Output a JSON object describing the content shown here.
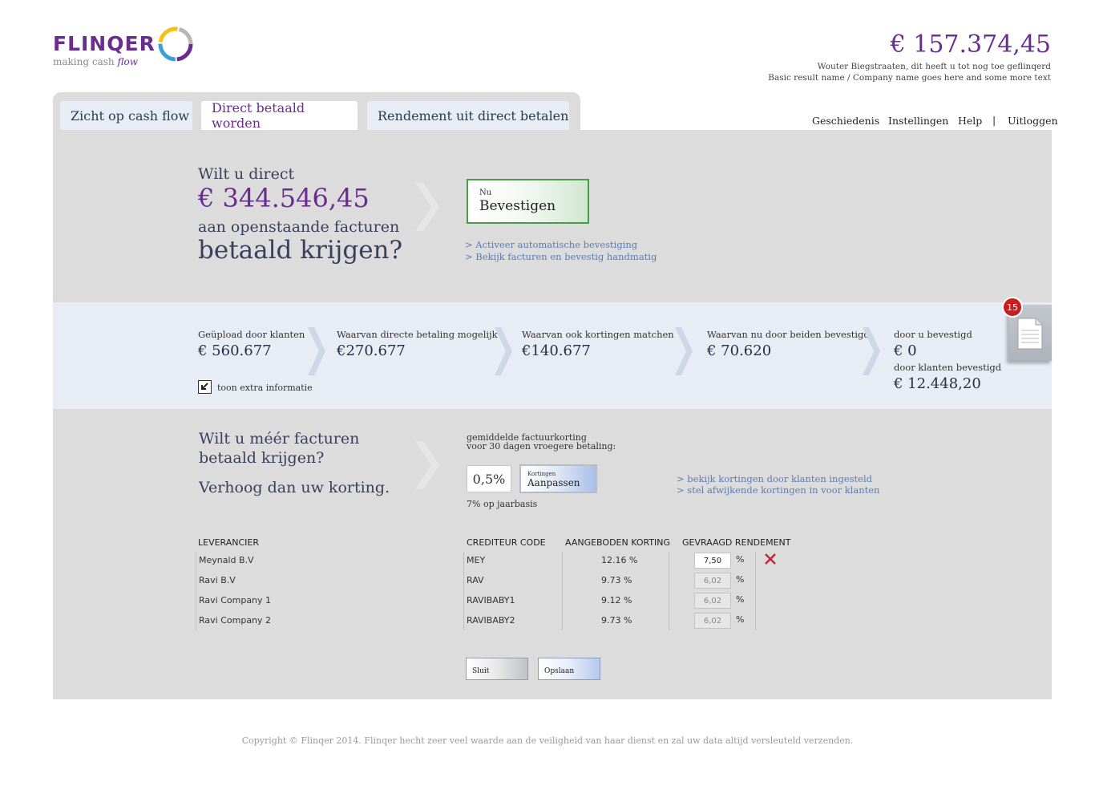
{
  "brand": {
    "name": "FLINQER",
    "tagline_prefix": "making cash",
    "tagline_italic": "flow",
    "color": "#6a2d8f"
  },
  "header": {
    "total_amount": "€ 157.374,45",
    "user_line": "Wouter Biegstraaten, dit heeft u tot nog toe geflinqerd",
    "company_line": "Basic result name / Company name goes here and some more text"
  },
  "tabs": [
    {
      "label": "Zicht op cash flow",
      "active": false
    },
    {
      "label": "Direct betaald worden",
      "active": true
    },
    {
      "label": "Rendement uit direct betalen",
      "active": false
    }
  ],
  "topnav": {
    "items": [
      "Geschiedenis",
      "Instellingen",
      "Help",
      "Uitloggen"
    ],
    "separator": "|"
  },
  "question": {
    "line1": "Wilt u direct",
    "amount": "€ 344.546,45",
    "line3": "aan openstaande facturen",
    "line4": "betaald krijgen?"
  },
  "confirm_button": {
    "small": "Nu",
    "label": "Bevestigen",
    "border_color": "#4a9a4a"
  },
  "confirm_links": [
    "> Activeer automatische bevestiging",
    "> Bekijk facturen en bevestig handmatig"
  ],
  "stats": [
    {
      "label": "Geüpload door klanten",
      "value": "€ 560.677"
    },
    {
      "label": "Waarvan directe betaling mogelijk",
      "value": "€270.677"
    },
    {
      "label": "Waarvan ook kortingen matchen",
      "value": "€140.677"
    },
    {
      "label": "Waarvan nu door beiden bevestigd",
      "value": "€ 70.620"
    },
    {
      "label": "door u bevestigd",
      "value": "€ 0"
    },
    {
      "label": "door klanten bevestigd",
      "value": "€ 12.448,20"
    }
  ],
  "extra_info_label": "toon extra informatie",
  "doc_badge": {
    "count": "15",
    "color": "#c81e1e",
    "icon": "document-icon"
  },
  "more": {
    "line1": "Wilt u méér facturen",
    "line2": "betaald krijgen?",
    "line3": "Verhoog dan uw korting."
  },
  "discount": {
    "label_line1": "gemiddelde factuurkorting",
    "label_line2": "voor 30 dagen vroegere betaling:",
    "value": "0,5%",
    "adjust_small": "Kortingen",
    "adjust_label": "Aanpassen",
    "yearly": "7% op jaarbasis"
  },
  "discount_links": [
    "> bekijk kortingen door klanten ingesteld",
    "> stel afwijkende kortingen in voor klanten"
  ],
  "table": {
    "headers": [
      "LEVERANCIER",
      "CREDITEUR CODE",
      "AANGEBODEN KORTING",
      "GEVRAAGD RENDEMENT"
    ],
    "rows": [
      {
        "supplier": "Meynald B.V",
        "code": "MEY",
        "discount": "12.16 %",
        "return": "7,50",
        "unit": "%",
        "active": true
      },
      {
        "supplier": "Ravi B.V",
        "code": "RAV",
        "discount": "9.73 %",
        "return": "6,02",
        "unit": "%",
        "active": false
      },
      {
        "supplier": "Ravi Company 1",
        "code": "RAVIBABY1",
        "discount": "9.12 %",
        "return": "6,02",
        "unit": "%",
        "active": false
      },
      {
        "supplier": "Ravi Company 2",
        "code": "RAVIBABY2",
        "discount": "9.73 %",
        "return": "6,02",
        "unit": "%",
        "active": false
      }
    ]
  },
  "actions": {
    "close": "Sluit",
    "save": "Opslaan"
  },
  "footer": "Copyright © Flinqer 2014. Flinqer hecht zeer veel waarde aan de veiligheid van haar dienst en zal uw data altijd versleuteld verzenden."
}
